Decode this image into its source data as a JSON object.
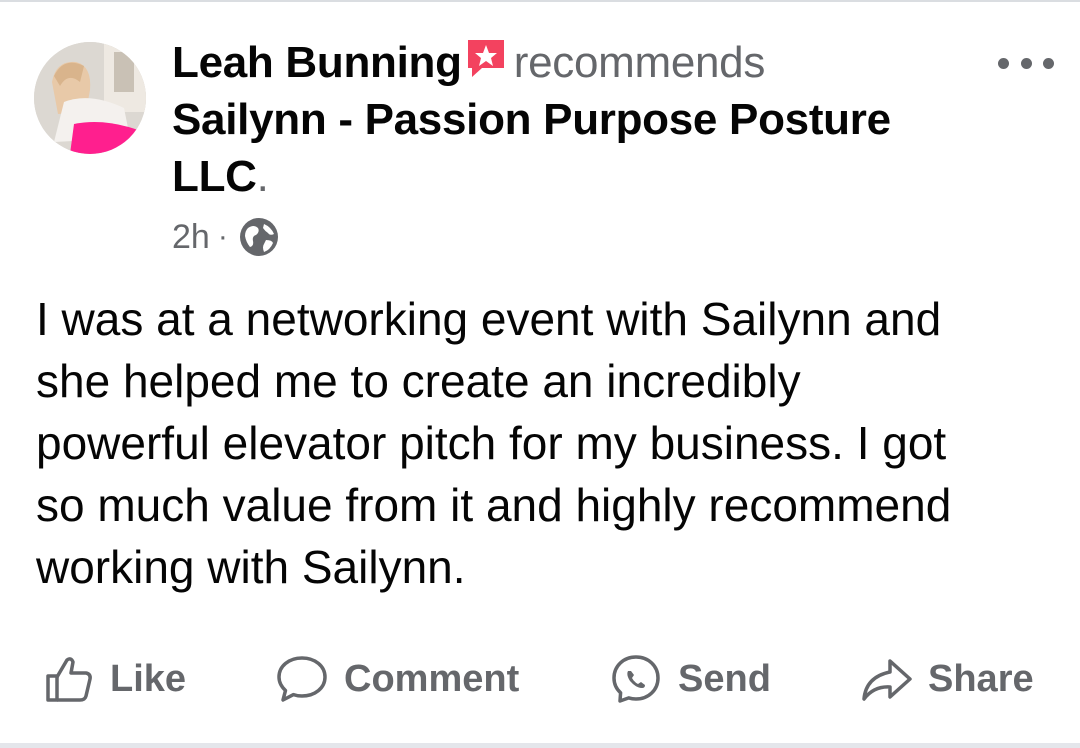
{
  "post": {
    "author": "Leah Bunning",
    "action": "recommends",
    "page_name": "Sailynn - Passion Purpose Posture LLC",
    "period": ".",
    "time": "2h",
    "separator": "·",
    "privacy_icon": "globe-icon",
    "badge_icon": "recommendation-star-icon",
    "body": "I was at a networking event with Sailynn and\nshe helped me to create an incredibly\npowerful elevator pitch for my business. I got\nso much value from it and highly recommend\nworking with Sailynn."
  },
  "actions": {
    "like": "Like",
    "comment": "Comment",
    "send": "Send",
    "share": "Share"
  },
  "colors": {
    "text": "#050505",
    "secondary": "#65676b",
    "badge": "#f3425f",
    "divider": "#e4e6eb"
  }
}
